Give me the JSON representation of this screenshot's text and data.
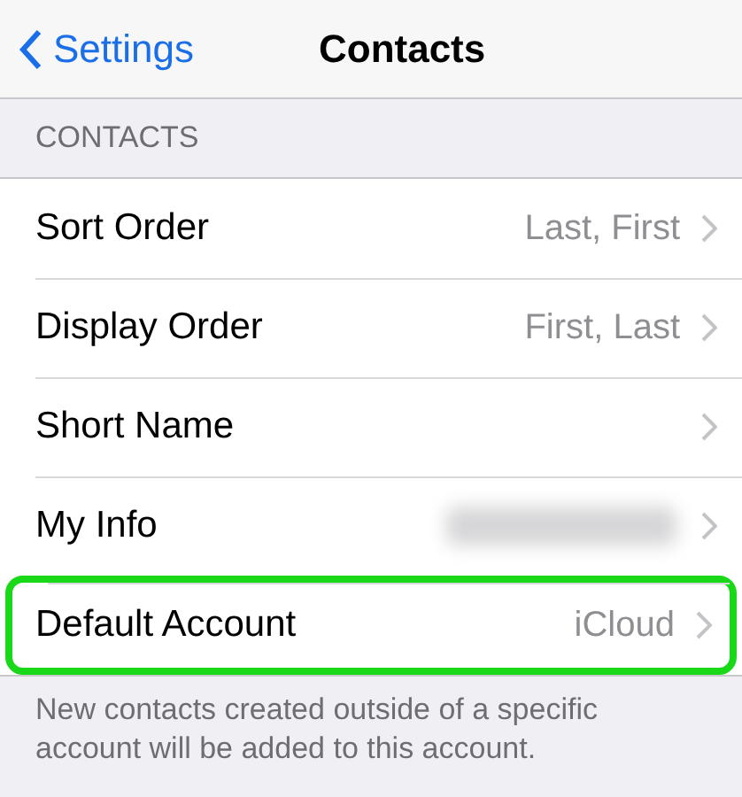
{
  "nav": {
    "back_label": "Settings",
    "title": "Contacts"
  },
  "section": {
    "header": "CONTACTS"
  },
  "rows": [
    {
      "label": "Sort Order",
      "kind": "value",
      "value": "Last, First",
      "highlighted": false
    },
    {
      "label": "Display Order",
      "kind": "value",
      "value": "First, Last",
      "highlighted": false
    },
    {
      "label": "Short Name",
      "kind": "plain",
      "highlighted": false
    },
    {
      "label": "My Info",
      "kind": "blurred",
      "highlighted": false
    },
    {
      "label": "Default Account",
      "kind": "value",
      "value": "iCloud",
      "highlighted": true
    }
  ],
  "footer": "New contacts created outside of a specific account will be added to this account."
}
